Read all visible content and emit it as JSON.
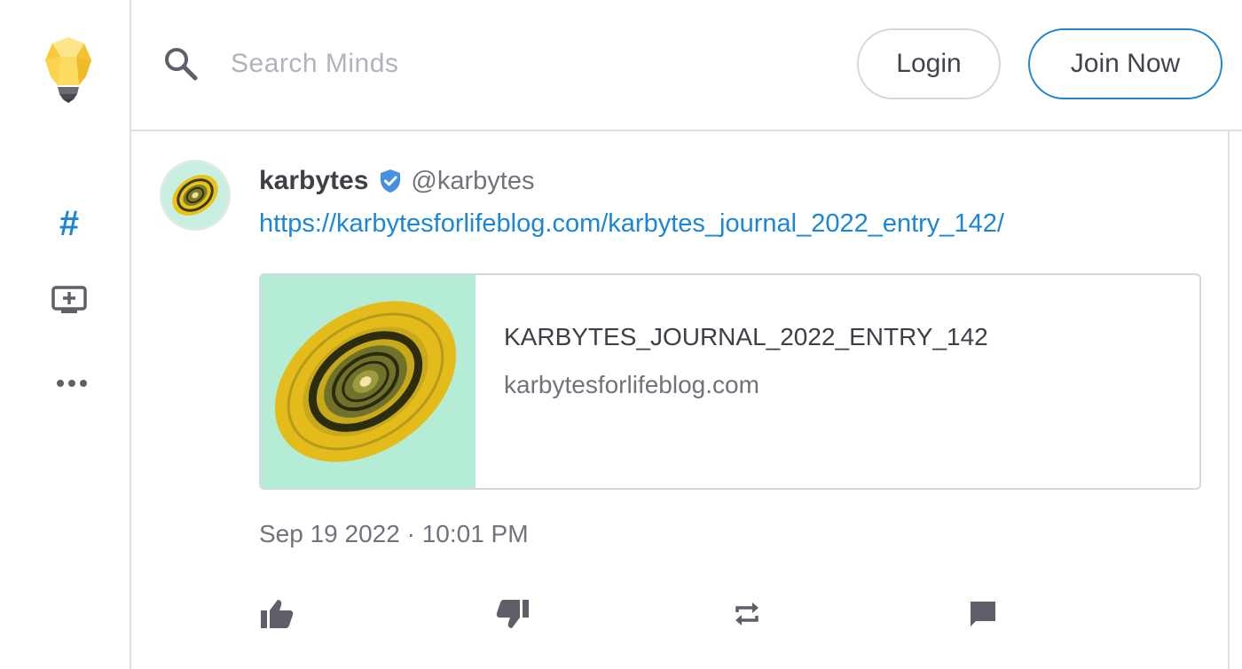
{
  "sidebar": {
    "icons": [
      "lightbulb-logo-icon",
      "hashtag-icon",
      "add-to-screen-icon",
      "more-horizontal-icon"
    ],
    "hash_glyph": "#",
    "accent_color": "#1b85d6"
  },
  "header": {
    "search": {
      "placeholder": "Search Minds",
      "value": ""
    },
    "login_label": "Login",
    "join_label": "Join Now"
  },
  "post": {
    "author_name": "karbytes",
    "author_handle": "@karbytes",
    "verified": true,
    "link_text": "https://karbytesforlifeblog.com/karbytes_journal_2022_entry_142/",
    "link_card": {
      "title": "KARBYTES_JOURNAL_2022_ENTRY_142",
      "domain": "karbytesforlifeblog.com"
    },
    "timestamp": "Sep 19 2022 · 10:01 PM",
    "actions": [
      "thumb-up-icon",
      "thumb-down-icon",
      "remind-icon",
      "comment-icon"
    ]
  },
  "colors": {
    "link": "#1b85d6",
    "text": "#43434d",
    "muted": "#72727c",
    "border": "#d3d7de"
  }
}
